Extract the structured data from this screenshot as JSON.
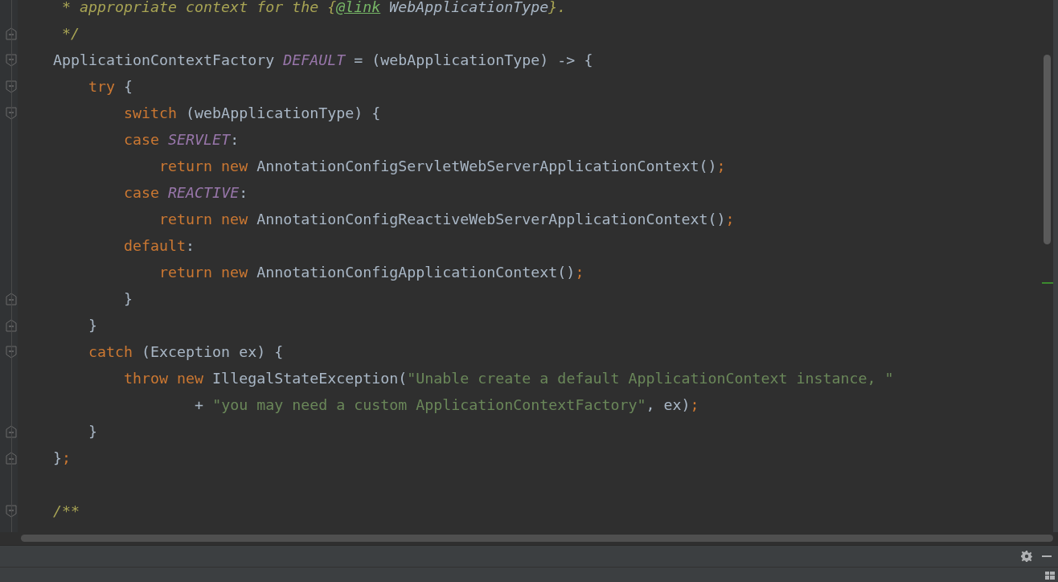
{
  "editor": {
    "lines": [
      {
        "tokens": [
          {
            "kind": "doc",
            "text": " * appropriate context for the {"
          },
          {
            "kind": "doc-tag",
            "text": "@link"
          },
          {
            "kind": "doc-ref",
            "text": " WebApplicationType"
          },
          {
            "kind": "doc",
            "text": "}."
          }
        ]
      },
      {
        "fold_end": true,
        "tokens": [
          {
            "kind": "doc",
            "text": " */"
          }
        ]
      },
      {
        "fold_start": true,
        "tokens": [
          {
            "kind": "plain",
            "text": "ApplicationContextFactory "
          },
          {
            "kind": "constant",
            "text": "DEFAULT"
          },
          {
            "kind": "plain",
            "text": " = (webApplicationType) -> {"
          }
        ]
      },
      {
        "fold_start": true,
        "tokens": [
          {
            "kind": "keyword",
            "text": "    try"
          },
          {
            "kind": "plain",
            "text": " {"
          }
        ]
      },
      {
        "fold_start": true,
        "tokens": [
          {
            "kind": "keyword",
            "text": "        switch"
          },
          {
            "kind": "plain",
            "text": " (webApplicationType) {"
          }
        ]
      },
      {
        "tokens": [
          {
            "kind": "keyword",
            "text": "        case "
          },
          {
            "kind": "constant",
            "text": "SERVLET"
          },
          {
            "kind": "plain",
            "text": ":"
          }
        ]
      },
      {
        "tokens": [
          {
            "kind": "keyword",
            "text": "            return new"
          },
          {
            "kind": "plain",
            "text": " AnnotationConfigServletWebServerApplicationContext()"
          },
          {
            "kind": "keyword",
            "text": ";"
          }
        ]
      },
      {
        "tokens": [
          {
            "kind": "keyword",
            "text": "        case "
          },
          {
            "kind": "constant",
            "text": "REACTIVE"
          },
          {
            "kind": "plain",
            "text": ":"
          }
        ]
      },
      {
        "tokens": [
          {
            "kind": "keyword",
            "text": "            return new"
          },
          {
            "kind": "plain",
            "text": " AnnotationConfigReactiveWebServerApplicationContext()"
          },
          {
            "kind": "keyword",
            "text": ";"
          }
        ]
      },
      {
        "tokens": [
          {
            "kind": "keyword",
            "text": "        default"
          },
          {
            "kind": "plain",
            "text": ":"
          }
        ]
      },
      {
        "tokens": [
          {
            "kind": "keyword",
            "text": "            return new"
          },
          {
            "kind": "plain",
            "text": " AnnotationConfigApplicationContext()"
          },
          {
            "kind": "keyword",
            "text": ";"
          }
        ]
      },
      {
        "fold_end": true,
        "tokens": [
          {
            "kind": "plain",
            "text": "        }"
          }
        ]
      },
      {
        "fold_end": true,
        "tokens": [
          {
            "kind": "plain",
            "text": "    }"
          }
        ]
      },
      {
        "fold_start": true,
        "tokens": [
          {
            "kind": "keyword",
            "text": "    catch"
          },
          {
            "kind": "plain",
            "text": " (Exception ex) {"
          }
        ]
      },
      {
        "tokens": [
          {
            "kind": "keyword",
            "text": "        throw new"
          },
          {
            "kind": "plain",
            "text": " IllegalStateException("
          },
          {
            "kind": "string",
            "text": "\"Unable create a default ApplicationContext instance, \""
          }
        ]
      },
      {
        "tokens": [
          {
            "kind": "plain",
            "text": "                + "
          },
          {
            "kind": "string",
            "text": "\"you may need a custom ApplicationContextFactory\""
          },
          {
            "kind": "plain",
            "text": ", ex)"
          },
          {
            "kind": "keyword",
            "text": ";"
          }
        ]
      },
      {
        "fold_end": true,
        "tokens": [
          {
            "kind": "plain",
            "text": "    }"
          }
        ]
      },
      {
        "fold_end": true,
        "tokens": [
          {
            "kind": "plain",
            "text": "}"
          },
          {
            "kind": "keyword",
            "text": ";"
          }
        ]
      },
      {
        "blank": true
      },
      {
        "fold_start": true,
        "tokens": [
          {
            "kind": "doc",
            "text": "/**"
          }
        ]
      }
    ]
  }
}
